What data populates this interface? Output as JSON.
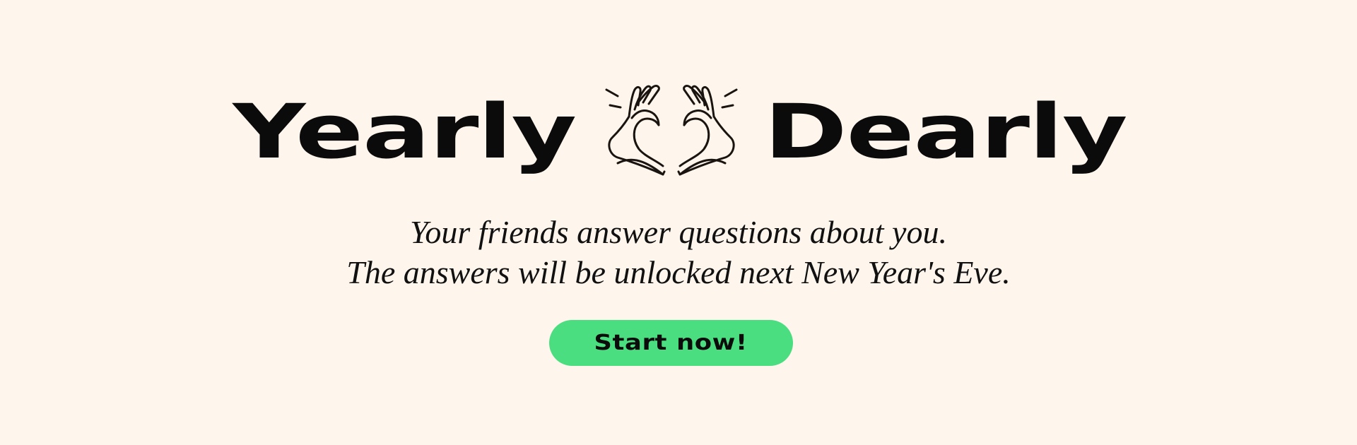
{
  "brand": {
    "title_left": "Yearly",
    "title_right": "Dearly",
    "logo_icon": "heart-hands-icon"
  },
  "hero": {
    "tagline_line1": "Your friends answer questions about you.",
    "tagline_line2": "The answers will be unlocked next New Year's Eve."
  },
  "cta": {
    "label": "Start now!"
  },
  "colors": {
    "background": "#FEF5EC",
    "text": "#0B0B0B",
    "accent": "#4ADE80"
  }
}
